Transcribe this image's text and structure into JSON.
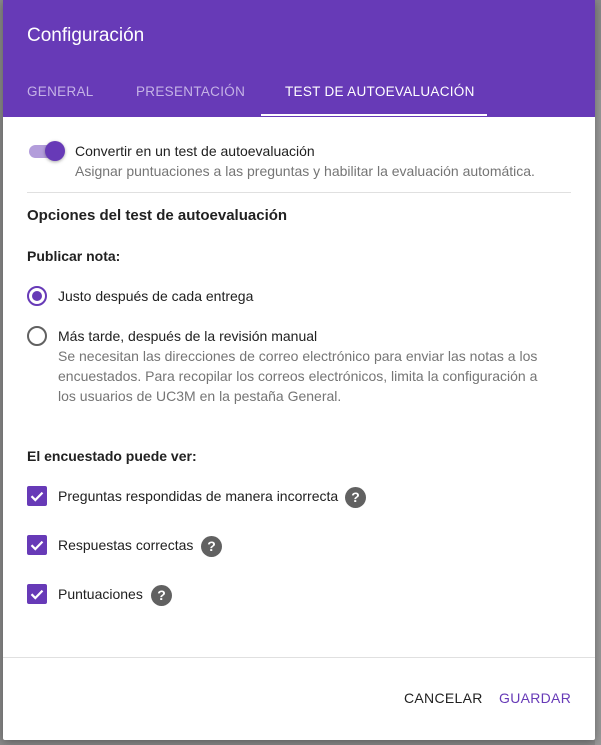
{
  "dialog": {
    "title": "Configuración",
    "tabs": [
      {
        "label": "GENERAL",
        "active": false
      },
      {
        "label": "PRESENTACIÓN",
        "active": false
      },
      {
        "label": "TEST DE AUTOEVALUACIÓN",
        "active": true
      }
    ],
    "quiz_toggle": {
      "on": true,
      "label": "Convertir en un test de autoevaluación",
      "description": "Asignar puntuaciones a las preguntas y habilitar la evaluación automática."
    },
    "section_title": "Opciones del test de autoevaluación",
    "release_grade": {
      "heading": "Publicar nota:",
      "options": [
        {
          "label": "Justo después de cada entrega",
          "selected": true
        },
        {
          "label": "Más tarde, después de la revisión manual",
          "selected": false,
          "note_lines": [
            "Se necesitan las direcciones de correo electrónico para enviar las notas a los",
            "encuestados. Para recopilar los correos electrónicos, limita la configuración a",
            "los usuarios de UC3M en la pestaña General."
          ]
        }
      ]
    },
    "respondent_can_see": {
      "heading": "El encuestado puede ver:",
      "options": [
        {
          "label": "Preguntas respondidas de manera incorrecta",
          "checked": true,
          "help": "?"
        },
        {
          "label": "Respuestas correctas",
          "checked": true,
          "help": "?"
        },
        {
          "label": "Puntuaciones",
          "checked": true,
          "help": "?"
        }
      ]
    },
    "actions": {
      "cancel": "CANCELAR",
      "save": "GUARDAR"
    }
  },
  "colors": {
    "accent": "#673ab7",
    "accent_light": "#b39ddb",
    "icon_gray": "#616161"
  }
}
